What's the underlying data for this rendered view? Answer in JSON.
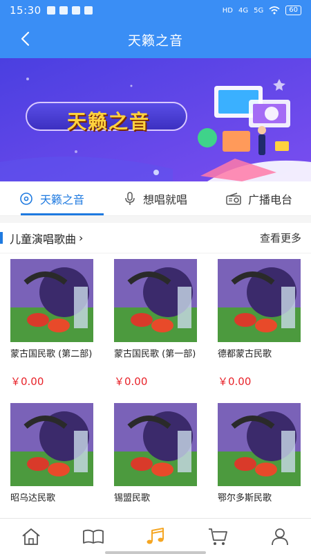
{
  "status_bar": {
    "time": "15:30",
    "network_left": "HD",
    "signal_1": "4G",
    "signal_2": "5G",
    "battery": "60"
  },
  "navbar": {
    "title": "天籁之音",
    "back_icon": "chevron-left-icon"
  },
  "banner": {
    "text": "天籁之音"
  },
  "tabs": [
    {
      "label": "天籁之音",
      "icon": "disc-icon",
      "active": true
    },
    {
      "label": "想唱就唱",
      "icon": "microphone-icon",
      "active": false
    },
    {
      "label": "广播电台",
      "icon": "radio-icon",
      "active": false
    }
  ],
  "section": {
    "title": "儿童演唱歌曲",
    "more": "查看更多",
    "items": [
      {
        "name": "蒙古国民歌 (第二部)",
        "price": "￥0.00"
      },
      {
        "name": "蒙古国民歌 (第一部)",
        "price": "￥0.00"
      },
      {
        "name": "德都蒙古民歌",
        "price": "￥0.00"
      },
      {
        "name": "昭乌达民歌",
        "price": ""
      },
      {
        "name": "锡盟民歌",
        "price": ""
      },
      {
        "name": "鄂尔多斯民歌",
        "price": ""
      }
    ]
  },
  "bottom_nav": [
    {
      "icon": "home-icon",
      "active": false
    },
    {
      "icon": "book-icon",
      "active": false
    },
    {
      "icon": "music-note-icon",
      "active": true
    },
    {
      "icon": "cart-icon",
      "active": false
    },
    {
      "icon": "user-icon",
      "active": false
    }
  ],
  "colors": {
    "primary": "#3a8ef5",
    "accent": "#1f7ae0",
    "price": "#e8232a",
    "music_active": "#f5a623"
  }
}
